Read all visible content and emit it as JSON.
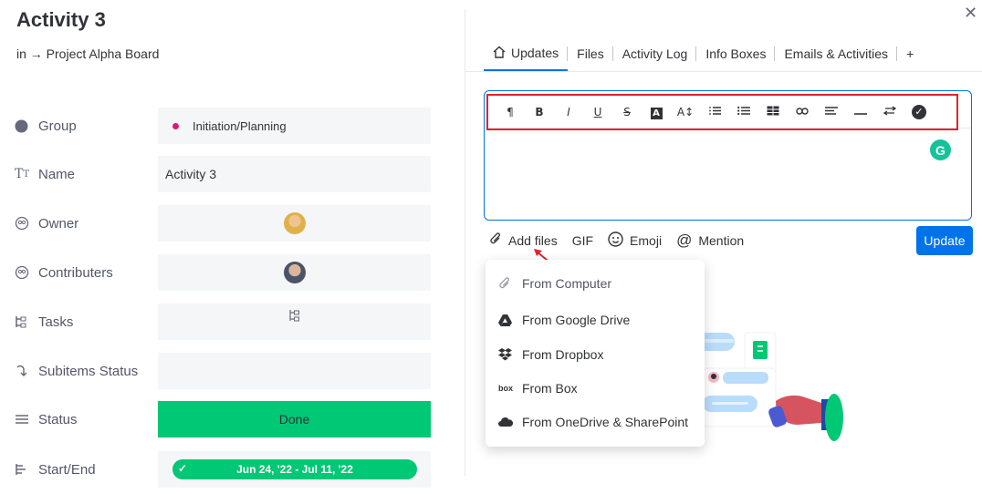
{
  "item": {
    "title": "Activity 3",
    "breadcrumb": "in → Project Alpha Board"
  },
  "fields": [
    {
      "label": "Group",
      "icon": "circle-icon",
      "value": "Initiation/Planning",
      "value_color": "#e2137c"
    },
    {
      "label": "Name",
      "icon": "text-icon",
      "value": "Activity 3"
    },
    {
      "label": "Owner",
      "icon": "people-icon",
      "value": ""
    },
    {
      "label": "Contributers",
      "icon": "people-icon",
      "value": ""
    },
    {
      "label": "Tasks",
      "icon": "subitems-icon",
      "value": "⊑"
    },
    {
      "label": "Subitems Status",
      "icon": "arrow-down-icon",
      "value": ""
    },
    {
      "label": "Status",
      "icon": "list-icon",
      "value": "Done",
      "value_color": "#00c875"
    },
    {
      "label": "Start/End",
      "icon": "timeline-icon",
      "value": "Jun 24, '22 - Jul 11, '22",
      "value_color": "#00c875"
    }
  ],
  "tabs": [
    "Updates",
    "Files",
    "Activity Log",
    "Info Boxes",
    "Emails & Activities",
    "+"
  ],
  "toolbar_buttons": [
    "¶",
    "B",
    "I",
    "U",
    "S",
    "A",
    "A↕",
    "ordered-list",
    "bullet-list",
    "table",
    "link",
    "align",
    "divider",
    "direction",
    "check"
  ],
  "actions": {
    "add_files": "Add files",
    "gif": "GIF",
    "emoji": "Emoji",
    "mention": "Mention",
    "update": "Update"
  },
  "dropdown": [
    {
      "label": "From Computer",
      "icon": "paperclip-icon"
    },
    {
      "label": "From Google Drive",
      "icon": "google-drive-icon"
    },
    {
      "label": "From Dropbox",
      "icon": "dropbox-icon"
    },
    {
      "label": "From Box",
      "icon": "box-icon",
      "icon_text": "box"
    },
    {
      "label": "From OneDrive & SharePoint",
      "icon": "onedrive-icon"
    }
  ],
  "colors": {
    "accent": "#0073ea",
    "done": "#00c875",
    "highlight": "#e2232a"
  }
}
